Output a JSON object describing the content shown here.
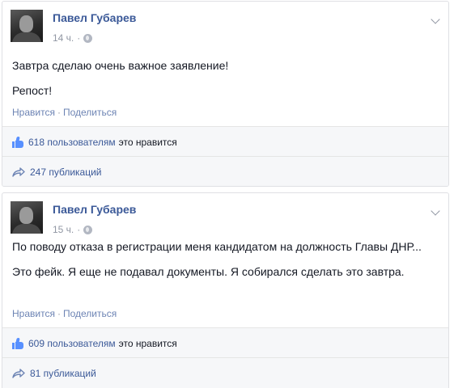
{
  "posts": [
    {
      "author": "Павел Губарев",
      "time": "14 ч.",
      "paragraphs": [
        "Завтра сделаю очень важное заявление!",
        "Репост!"
      ],
      "actions": {
        "like": "Нравится",
        "separator": "·",
        "share": "Поделиться"
      },
      "likes": {
        "count": "618 пользователям",
        "suffix": "это нравится"
      },
      "shares": {
        "count": "247 публикаций"
      }
    },
    {
      "author": "Павел Губарев",
      "time": "15 ч.",
      "paragraphs": [
        "По поводу отказа в регистрации меня кандидатом на должность Главы ДНР...",
        "Это фейк. Я еще не подавал документы. Я собирался сделать это завтра."
      ],
      "actions": {
        "like": "Нравится",
        "separator": "·",
        "share": "Поделиться"
      },
      "likes": {
        "count": "609 пользователям",
        "suffix": "это нравится"
      },
      "shares": {
        "count": "81 публикаций"
      }
    }
  ],
  "icons": {
    "privacy": "globe-icon",
    "menu": "chevron-down-icon",
    "like": "like-icon",
    "share": "share-icon"
  },
  "colors": {
    "link": "#3b5998",
    "action_link": "#6d84b4",
    "muted": "#9197a3",
    "like_blue": "#5890ff",
    "footer_bg": "#f6f7f9"
  }
}
